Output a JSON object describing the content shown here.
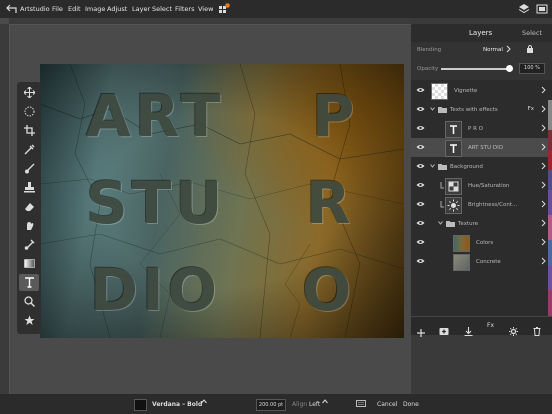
{
  "menubar": {
    "app_name": "Artstudio",
    "items": [
      "File",
      "Edit",
      "Image",
      "Adjust",
      "Layer",
      "Select",
      "Filters",
      "View"
    ],
    "badge": "2"
  },
  "canvas": {
    "words": [
      "ART",
      "P",
      "STU",
      "R",
      "DIO",
      "O"
    ]
  },
  "tools": [
    "move-icon",
    "marquee-icon",
    "crop-icon",
    "eyedropper-icon",
    "brush-icon",
    "stamp-icon",
    "eraser-icon",
    "smudge-icon",
    "fill-icon",
    "gradient-icon",
    "text-icon",
    "zoom-icon",
    "star-icon"
  ],
  "panel": {
    "title": "Layers",
    "select_label": "Select",
    "blending_label": "Blending",
    "blending_value": "Normal",
    "opacity_label": "Opacity",
    "opacity_value": "100 %",
    "opacity_fraction": 1.0,
    "layers": [
      {
        "name": "Vignette",
        "type": "checker"
      },
      {
        "name": "Texts with effects",
        "type": "folder",
        "fx": "Fx"
      },
      {
        "name": "P R O",
        "type": "text"
      },
      {
        "name": "ART STU DIO",
        "type": "text",
        "selected": true
      },
      {
        "name": "Background",
        "type": "folder"
      },
      {
        "name": "Hue/Saturation",
        "type": "adjust"
      },
      {
        "name": "Brightness/Cont...",
        "type": "adjust2"
      },
      {
        "name": "Texture",
        "type": "folder"
      },
      {
        "name": "Colors",
        "type": "image"
      },
      {
        "name": "Concrete",
        "type": "image"
      }
    ],
    "footer_icons": [
      "add-layer-icon",
      "add-group-icon",
      "merge-down-icon",
      "fx-icon",
      "settings-icon",
      "delete-icon"
    ],
    "fx_label": "Fx"
  },
  "bottom": {
    "font": "Verdana – Bold",
    "size": "200.00 pt",
    "align_label": "Align",
    "align_value": "Left",
    "cancel": "Cancel",
    "done": "Done"
  },
  "colors": {
    "accent": "#ffffff",
    "selected_row": "#4b4b4b"
  }
}
